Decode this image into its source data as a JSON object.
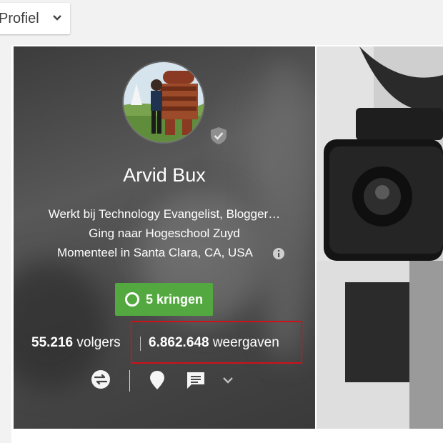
{
  "topbar": {
    "profile_dropdown_label": "Profiel"
  },
  "profile": {
    "name": "Arvid Bux",
    "info_lines": [
      "Werkt bij Technology Evangelist, Blogger…",
      "Ging naar Hogeschool Zuyd",
      "Momenteel in Santa Clara, CA, USA"
    ],
    "circles_button": "5 kringen",
    "followers_count": "55.216",
    "followers_label": "volgers",
    "views_count": "6.862.648",
    "views_label": "weergaven"
  },
  "colors": {
    "circles_button": "#53a93f",
    "highlight_box": "#d0111a"
  },
  "icons": {
    "verified": "shield-check-icon",
    "info": "info-icon",
    "share": "share-arrows-icon",
    "location": "location-pin-icon",
    "message": "chat-bubble-icon",
    "more": "chevron-down-icon"
  }
}
